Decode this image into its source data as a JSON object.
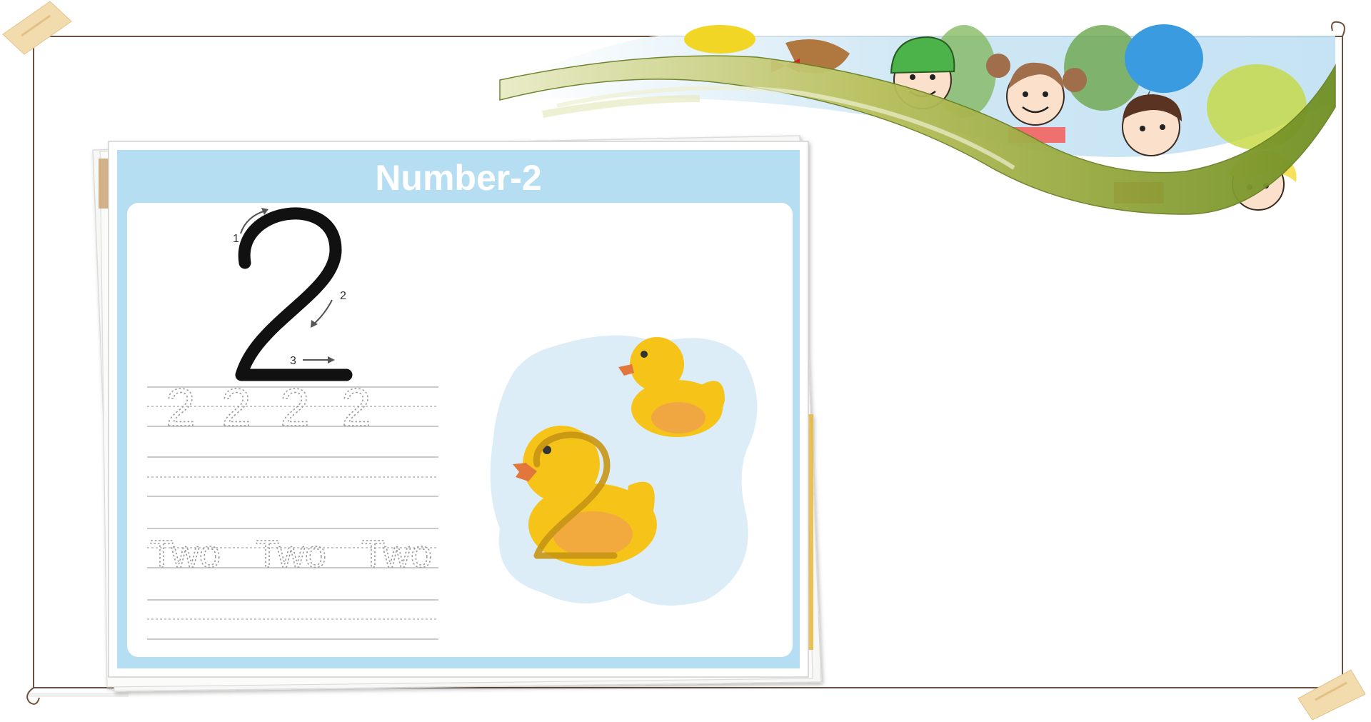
{
  "worksheet": {
    "title": "Number-2",
    "big_numeral": "2",
    "stroke_order": [
      "1",
      "2",
      "3"
    ],
    "trace_numerals": [
      "2",
      "2",
      "2",
      "2"
    ],
    "trace_words": [
      "Two",
      "Two",
      "Two"
    ]
  },
  "illustration": {
    "duck_count": 2,
    "icon": "duck-icon"
  },
  "colors": {
    "header_blue": "#b5def3",
    "pond_blue": "#dcedf8",
    "duck_yellow": "#f6c419",
    "duck_wing": "#f0a04b",
    "branch_green": "#8fa53a",
    "frame_brown": "#6b5240",
    "tape": "#f2dcae"
  }
}
